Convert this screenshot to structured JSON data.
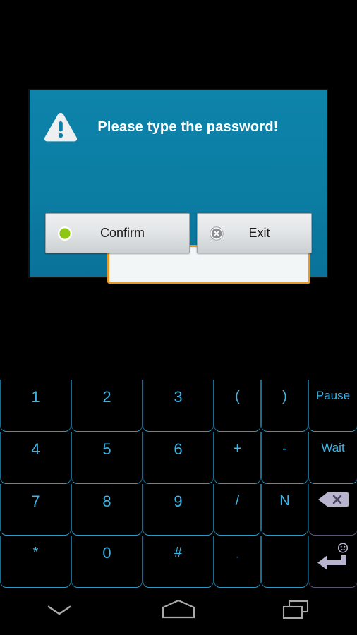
{
  "dialog": {
    "title": "Please type the password!",
    "warn_icon": "warning-triangle-icon",
    "accent_color": "#0C7FA6",
    "border_color": "#E89A28",
    "password_field": {
      "value": "",
      "placeholder": ""
    },
    "buttons": [
      {
        "label": "Confirm",
        "icon": "green-dot-icon",
        "icon_color": "#8DC713"
      },
      {
        "label": "Exit",
        "icon": "close-circle-icon",
        "icon_color": "#8A8F92"
      }
    ]
  },
  "keyboard": {
    "key_color": "#3BB6E8",
    "rows": [
      [
        {
          "label": "1",
          "name": "key-1",
          "type": "num"
        },
        {
          "label": "2",
          "name": "key-2",
          "type": "num"
        },
        {
          "label": "3",
          "name": "key-3",
          "type": "num"
        },
        {
          "label": "(",
          "name": "key-paren-open",
          "type": "sym"
        },
        {
          "label": ")",
          "name": "key-paren-close",
          "type": "sym"
        },
        {
          "label": "Pause",
          "name": "key-pause",
          "type": "word"
        }
      ],
      [
        {
          "label": "4",
          "name": "key-4",
          "type": "num"
        },
        {
          "label": "5",
          "name": "key-5",
          "type": "num"
        },
        {
          "label": "6",
          "name": "key-6",
          "type": "num"
        },
        {
          "label": "+",
          "name": "key-plus",
          "type": "sym"
        },
        {
          "label": "-",
          "name": "key-minus",
          "type": "sym"
        },
        {
          "label": "Wait",
          "name": "key-wait",
          "type": "word"
        }
      ],
      [
        {
          "label": "7",
          "name": "key-7",
          "type": "num"
        },
        {
          "label": "8",
          "name": "key-8",
          "type": "num"
        },
        {
          "label": "9",
          "name": "key-9",
          "type": "num"
        },
        {
          "label": "/",
          "name": "key-slash",
          "type": "sym"
        },
        {
          "label": "N",
          "name": "key-n",
          "type": "sym"
        },
        {
          "label": "",
          "name": "key-backspace",
          "type": "icon",
          "icon": "backspace-icon"
        }
      ],
      [
        {
          "label": "*",
          "name": "key-asterisk",
          "type": "sym"
        },
        {
          "label": "0",
          "name": "key-0",
          "type": "num"
        },
        {
          "label": "#",
          "name": "key-hash",
          "type": "sym"
        },
        {
          "label": ".",
          "name": "key-period",
          "type": "dim"
        },
        {
          "label": "",
          "name": "key-blank",
          "type": "blank"
        },
        {
          "label": "",
          "name": "key-enter",
          "type": "icon",
          "icon": "enter-icon"
        }
      ]
    ]
  },
  "navbar": {
    "buttons": [
      {
        "name": "nav-hide-keyboard-button",
        "icon": "chevron-down-icon"
      },
      {
        "name": "nav-home-button",
        "icon": "home-icon"
      },
      {
        "name": "nav-recents-button",
        "icon": "recents-icon"
      }
    ]
  }
}
